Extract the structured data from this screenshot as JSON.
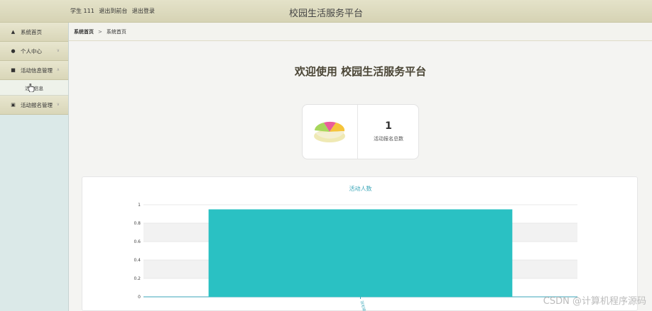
{
  "header": {
    "user_label": "学生 111",
    "back_link": "退出到前台",
    "logout_link": "退出登录",
    "app_title": "校园生活服务平台"
  },
  "sidebar": {
    "items": [
      {
        "label": "系统首页",
        "icon": "home-icon"
      },
      {
        "label": "个人中心",
        "icon": "user-icon"
      },
      {
        "label": "活动信息管理",
        "icon": "briefcase-icon"
      },
      {
        "label": "活动报名管理",
        "icon": "form-icon"
      }
    ],
    "submenu_label": "活动信息"
  },
  "breadcrumb": {
    "root": "系统首页",
    "separator": ">",
    "current": "系统首页"
  },
  "welcome_text": "欢迎使用 校园生活服务平台",
  "stat": {
    "value": "1",
    "label": "活动报名总数"
  },
  "colors": {
    "bar": "#2ac1c3",
    "chart_title": "#3aa6b8",
    "header_bg": "#dcd9bd"
  },
  "chart_data": {
    "type": "bar",
    "title": "活动人数",
    "categories": [
      "羽毛球赛"
    ],
    "values": [
      1
    ],
    "ylim": [
      0,
      1
    ],
    "yticks": [
      "0",
      "0.2",
      "0.4",
      "0.6",
      "0.8",
      "1"
    ],
    "grid": true
  },
  "watermark": "CSDN @计算机程序源码"
}
